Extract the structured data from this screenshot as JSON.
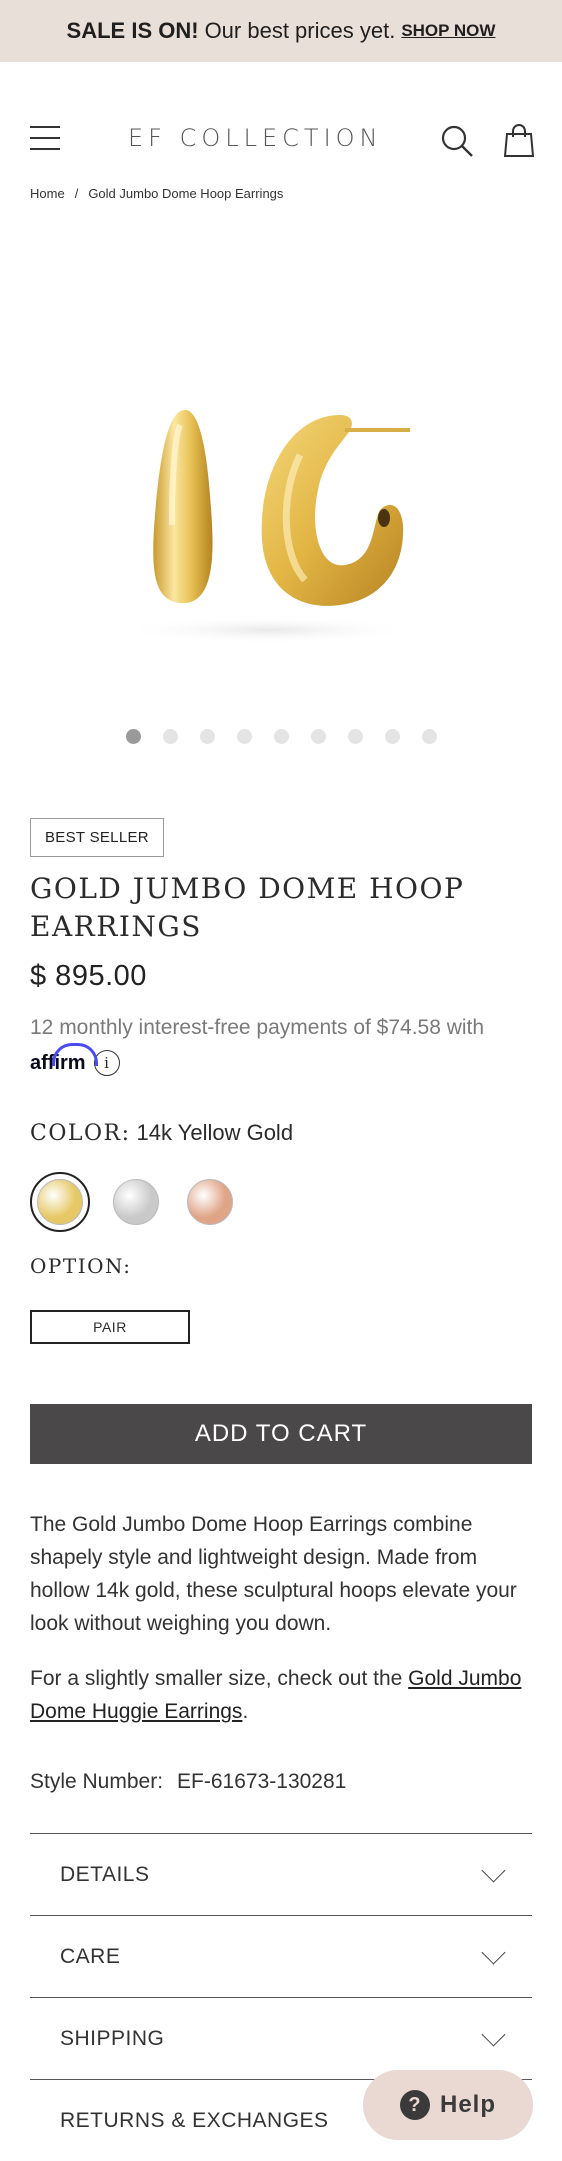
{
  "banner": {
    "bold": "SALE IS ON!",
    "text": "Our best prices yet.",
    "link": "SHOP NOW"
  },
  "header": {
    "logo": "EF COLLECTION",
    "icons": [
      "menu-icon",
      "search-icon",
      "bag-icon"
    ]
  },
  "breadcrumb": {
    "home": "Home",
    "separator": "/",
    "current": "Gold Jumbo Dome Hoop Earrings"
  },
  "gallery": {
    "total_images": 9,
    "active_index": 0
  },
  "product": {
    "badge": "BEST SELLER",
    "title": "GOLD JUMBO DOME HOOP EARRINGS",
    "price": "$ 895.00",
    "affirm_text": "12 monthly interest-free payments of $74.58 with",
    "affirm_logo": "affirm",
    "info_symbol": "i",
    "color_label": "COLOR:",
    "color_value": "14k Yellow Gold",
    "colors": [
      {
        "name": "14k Yellow Gold",
        "hex": "#e7c866",
        "selected": true
      },
      {
        "name": "White Gold",
        "hex": "#c9c9c9",
        "selected": false
      },
      {
        "name": "Rose Gold",
        "hex": "#e0a487",
        "selected": false
      }
    ],
    "option_label": "OPTION:",
    "option_value": "PAIR",
    "add_to_cart": "ADD TO CART",
    "description": "The Gold Jumbo Dome Hoop Earrings combine shapely style and lightweight design. Made from hollow 14k gold, these sculptural hoops elevate your look without weighing you down.",
    "desc2_prefix": "For a slightly smaller size, check out the",
    "desc2_link": "Gold Jumbo Dome Huggie Earrings",
    "desc2_suffix": ".",
    "style_label": "Style Number:",
    "style_value": "EF-61673-130281"
  },
  "accordion": [
    "DETAILS",
    "CARE",
    "SHIPPING",
    "RETURNS & EXCHANGES"
  ],
  "help": {
    "label": "Help",
    "icon": "?"
  },
  "colors": {
    "banner_bg": "#e9dfd9",
    "cart_bg": "#4a4849",
    "help_bg": "#ead9d3",
    "gold": "#e7c866"
  }
}
